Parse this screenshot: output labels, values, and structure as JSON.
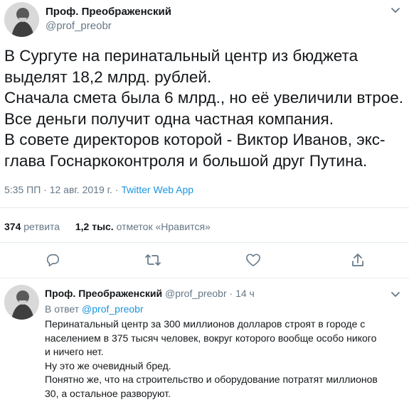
{
  "tweet": {
    "author_name": "Проф. Преображенский",
    "author_handle": "@prof_preobr",
    "lines": [
      "В Сургуте на перинатальный центр из бюджета",
      "выделят 18,2 млрд. рублей.",
      "Сначала смета была 6 млрд., но её увеличили втрое.",
      "Все деньги получит одна частная компания.",
      "В совете директоров которой - Виктор Иванов, экс-",
      "глава Госнаркоконтроля и большой друг Путина."
    ],
    "time": "5:35 ПП",
    "separator1": " · ",
    "date": "12 авг. 2019 г.",
    "separator2": " · ",
    "source": "Twitter Web App",
    "retweets_count": "374",
    "retweets_label": "ретвита",
    "likes_count": "1,2 тыс.",
    "likes_label": "отметок «Нравится»"
  },
  "reply": {
    "author_name": "Проф. Преображенский",
    "author_handle": "@prof_preobr",
    "dot": "·",
    "age": "14 ч",
    "in_reply_prefix": "В ответ",
    "in_reply_handle": "@prof_preobr",
    "lines": [
      "Перинатальный центр за 300 миллионов долларов строят в городе с",
      "населением в 375 тысяч человек, вокруг которого вообще особо никого",
      "и ничего нет.",
      "Ну это же очевидный бред.",
      "Понятно же, что на строительство и оборудование потратят миллионов",
      "30, а остальное разворуют."
    ]
  },
  "icons": [
    "reply-icon",
    "retweet-icon",
    "like-icon",
    "share-icon",
    "chevron-down-icon",
    "avatar-image"
  ],
  "colors": {
    "link": "#1b95e0",
    "muted": "#657786",
    "text": "#14171a",
    "divider": "#e6ecf0"
  }
}
